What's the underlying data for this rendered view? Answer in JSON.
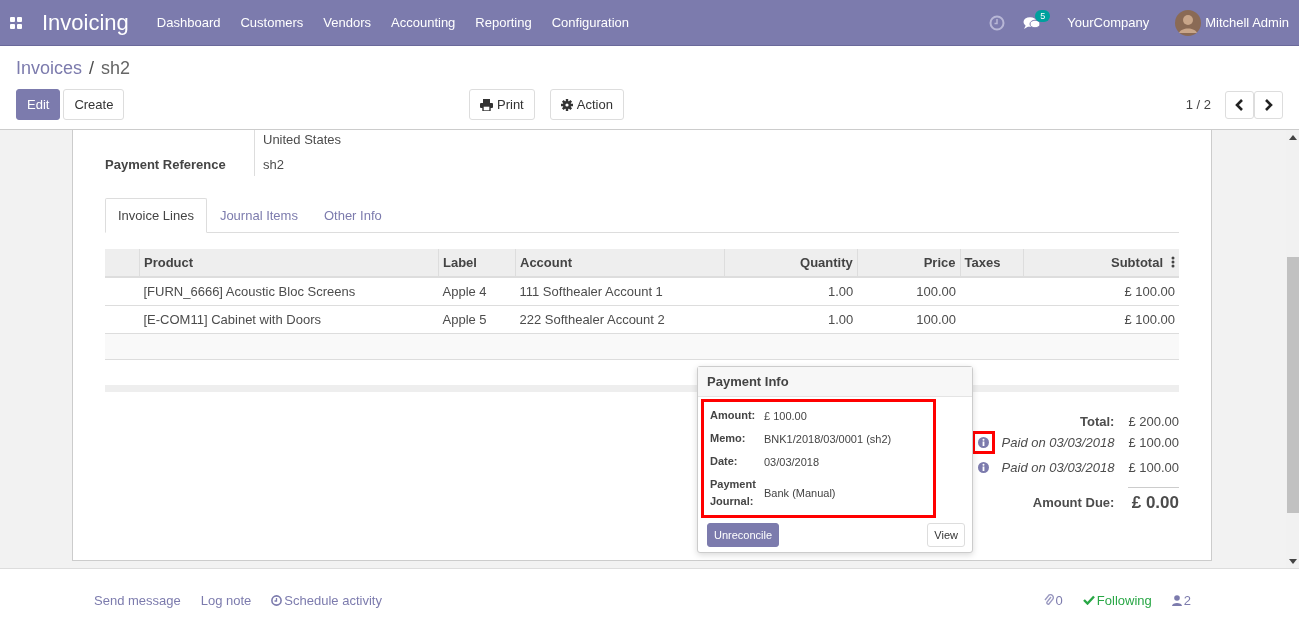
{
  "navbar": {
    "app_title": "Invoicing",
    "menu": [
      "Dashboard",
      "Customers",
      "Vendors",
      "Accounting",
      "Reporting",
      "Configuration"
    ],
    "message_count": "5",
    "company": "YourCompany",
    "user": "Mitchell Admin"
  },
  "breadcrumb": {
    "parent": "Invoices",
    "separator": "/",
    "current": "sh2"
  },
  "buttons": {
    "edit": "Edit",
    "create": "Create",
    "print": "Print",
    "action": "Action"
  },
  "pager": "1 / 2",
  "form": {
    "address_line": "United States",
    "fields": [
      {
        "label": "Payment Reference",
        "value": "sh2"
      }
    ]
  },
  "tabs": [
    {
      "label": "Invoice Lines",
      "selected": true
    },
    {
      "label": "Journal Items",
      "selected": false
    },
    {
      "label": "Other Info",
      "selected": false
    }
  ],
  "table": {
    "columns": [
      {
        "label": "Product",
        "kind": "text"
      },
      {
        "label": "Label",
        "kind": "text"
      },
      {
        "label": "Account",
        "kind": "text"
      },
      {
        "label": "Quantity",
        "kind": "number"
      },
      {
        "label": "Price",
        "kind": "number"
      },
      {
        "label": "Taxes",
        "kind": "text"
      },
      {
        "label": "Subtotal",
        "kind": "number"
      }
    ],
    "rows": [
      [
        "[FURN_6666] Acoustic Bloc Screens",
        "Apple 4",
        "111 Softhealer Account 1",
        "1.00",
        "100.00",
        "",
        "£ 100.00"
      ],
      [
        "[E-COM11] Cabinet with Doors",
        "Apple 5",
        "222 Softhealer Account 2",
        "1.00",
        "100.00",
        "",
        "£ 100.00"
      ]
    ]
  },
  "totals": {
    "total_label": "Total:",
    "total_value": "£ 200.00",
    "payments": [
      {
        "text": "Paid on 03/03/2018",
        "amount": "£ 100.00",
        "highlighted": true
      },
      {
        "text": "Paid on 03/03/2018",
        "amount": "£ 100.00",
        "highlighted": false
      }
    ],
    "due_label": "Amount Due:",
    "due_value": "£ 0.00"
  },
  "popover": {
    "title": "Payment Info",
    "highlighted": true,
    "details": [
      {
        "label": "Amount:",
        "value": "£ 100.00"
      },
      {
        "label": "Memo:",
        "value": "BNK1/2018/03/0001 (sh2)"
      },
      {
        "label": "Date:",
        "value": "03/03/2018"
      },
      {
        "label": "Payment Journal:",
        "value": "Bank (Manual)"
      }
    ],
    "unreconcile": "Unreconcile",
    "view": "View"
  },
  "chatter": {
    "send_message": "Send message",
    "log_note": "Log note",
    "schedule_activity": "Schedule activity",
    "attachments": "0",
    "following": "Following",
    "followers": "2"
  }
}
